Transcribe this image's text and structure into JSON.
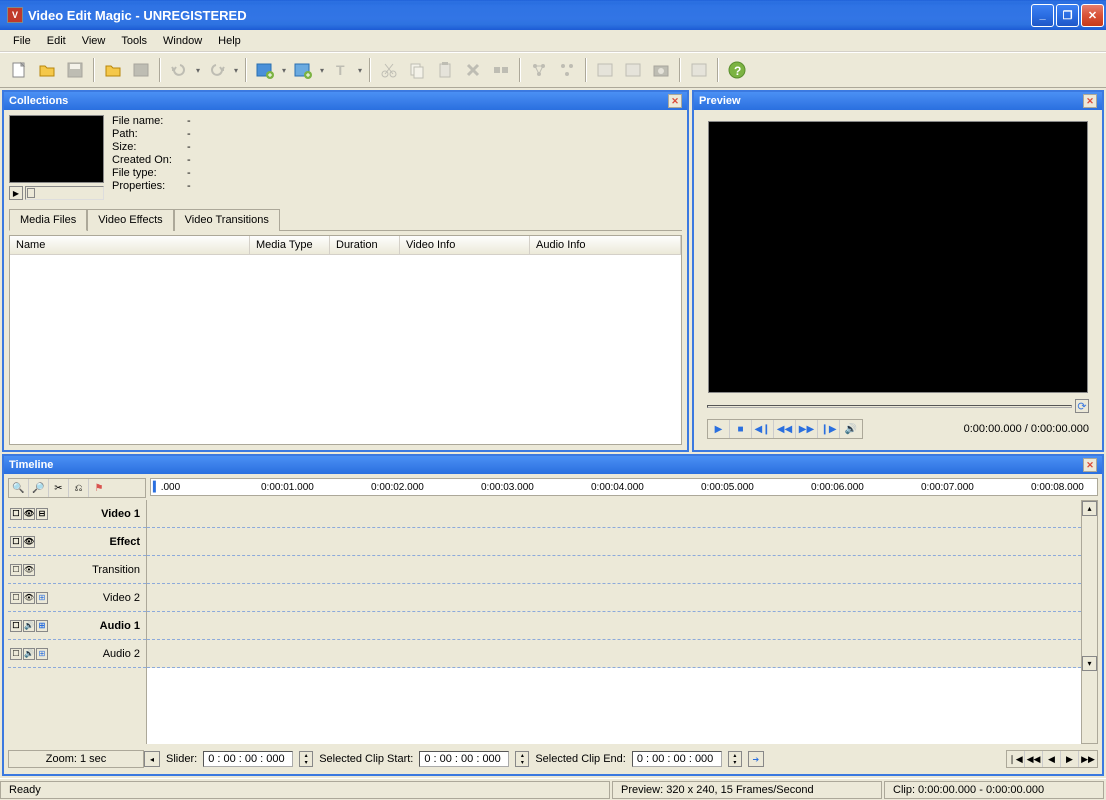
{
  "titlebar": {
    "title": "Video Edit Magic - UNREGISTERED"
  },
  "menu": {
    "file": "File",
    "edit": "Edit",
    "view": "View",
    "tools": "Tools",
    "window": "Window",
    "help": "Help"
  },
  "collections": {
    "title": "Collections",
    "props": {
      "filename_label": "File name:",
      "filename_val": "-",
      "path_label": "Path:",
      "path_val": "-",
      "size_label": "Size:",
      "size_val": "-",
      "created_label": "Created On:",
      "created_val": "-",
      "filetype_label": "File type:",
      "filetype_val": "-",
      "properties_label": "Properties:",
      "properties_val": "-"
    },
    "tabs": {
      "media": "Media Files",
      "effects": "Video Effects",
      "transitions": "Video Transitions"
    },
    "columns": {
      "name": "Name",
      "mediatype": "Media Type",
      "duration": "Duration",
      "videoinfo": "Video Info",
      "audioinfo": "Audio Info"
    }
  },
  "preview": {
    "title": "Preview",
    "time": "0:00:00.000 / 0:00:00.000"
  },
  "timeline": {
    "title": "Timeline",
    "ruler": [
      ".000",
      "0:00:01.000",
      "0:00:02.000",
      "0:00:03.000",
      "0:00:04.000",
      "0:00:05.000",
      "0:00:06.000",
      "0:00:07.000",
      "0:00:08.000"
    ],
    "tracks": {
      "video1": "Video 1",
      "effect": "Effect",
      "transition": "Transition",
      "video2": "Video 2",
      "audio1": "Audio 1",
      "audio2": "Audio 2"
    },
    "zoom": "Zoom: 1 sec",
    "fields": {
      "slider_label": "Slider:",
      "slider_val": "0 : 00 : 00 : 000",
      "start_label": "Selected Clip Start:",
      "start_val": "0 : 00 : 00 : 000",
      "end_label": "Selected Clip End:",
      "end_val": "0 : 00 : 00 : 000"
    }
  },
  "statusbar": {
    "ready": "Ready",
    "preview": "Preview: 320 x 240, 15 Frames/Second",
    "clip": "Clip: 0:00:00.000 - 0:00:00.000"
  }
}
